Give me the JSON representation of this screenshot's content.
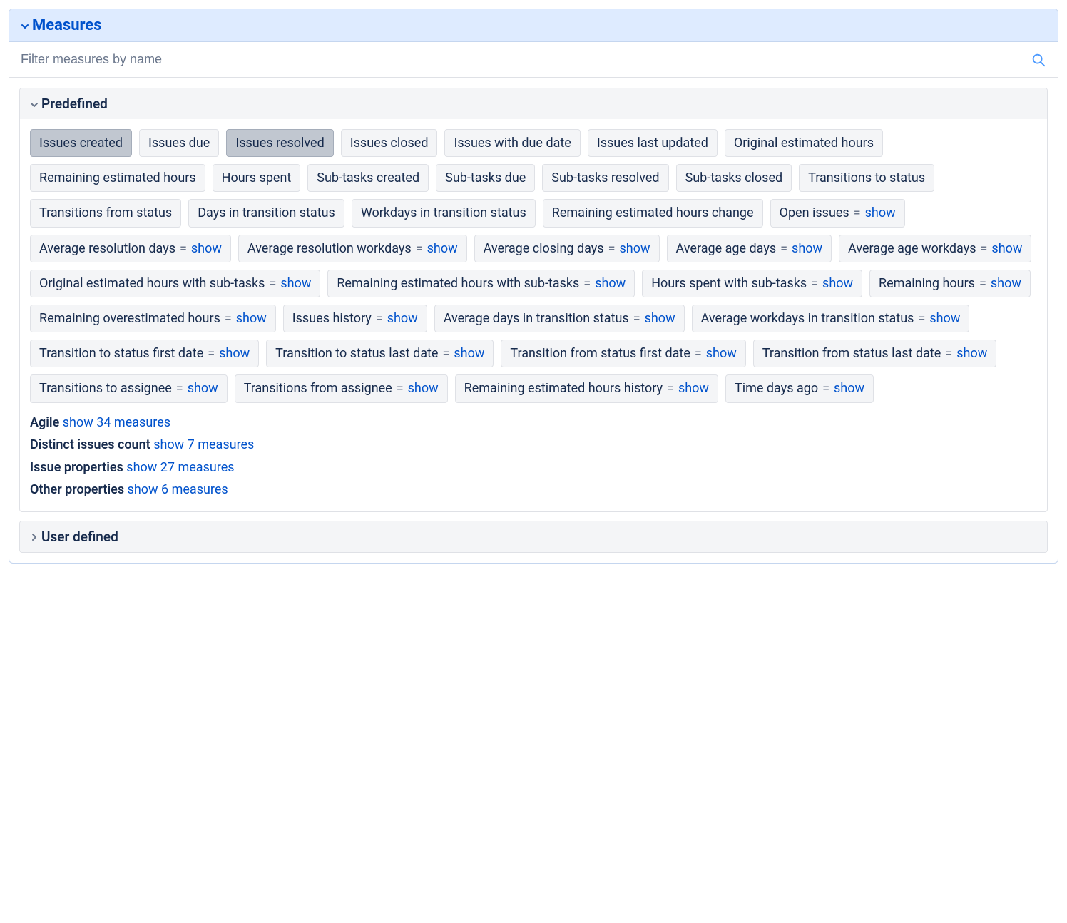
{
  "panel": {
    "title": "Measures"
  },
  "filter": {
    "placeholder": "Filter measures by name"
  },
  "sections": {
    "predefined": {
      "title": "Predefined",
      "expanded": true
    },
    "user_defined": {
      "title": "User defined",
      "expanded": false
    }
  },
  "eq": "=",
  "show": "show",
  "chips": [
    {
      "label": "Issues created",
      "selected": true
    },
    {
      "label": "Issues due"
    },
    {
      "label": "Issues resolved",
      "selected": true
    },
    {
      "label": "Issues closed"
    },
    {
      "label": "Issues with due date"
    },
    {
      "label": "Issues last updated"
    },
    {
      "label": "Original estimated hours"
    },
    {
      "label": "Remaining estimated hours"
    },
    {
      "label": "Hours spent"
    },
    {
      "label": "Sub-tasks created"
    },
    {
      "label": "Sub-tasks due"
    },
    {
      "label": "Sub-tasks resolved"
    },
    {
      "label": "Sub-tasks closed"
    },
    {
      "label": "Transitions to status"
    },
    {
      "label": "Transitions from status"
    },
    {
      "label": "Days in transition status"
    },
    {
      "label": "Workdays in transition status"
    },
    {
      "label": "Remaining estimated hours change"
    },
    {
      "label": "Open issues",
      "show": true
    },
    {
      "label": "Average resolution days",
      "show": true
    },
    {
      "label": "Average resolution workdays",
      "show": true
    },
    {
      "label": "Average closing days",
      "show": true
    },
    {
      "label": "Average age days",
      "show": true
    },
    {
      "label": "Average age workdays",
      "show": true
    },
    {
      "label": "Original estimated hours with sub-tasks",
      "show": true
    },
    {
      "label": "Remaining estimated hours with sub-tasks",
      "show": true
    },
    {
      "label": "Hours spent with sub-tasks",
      "show": true
    },
    {
      "label": "Remaining hours",
      "show": true
    },
    {
      "label": "Remaining overestimated hours",
      "show": true
    },
    {
      "label": "Issues history",
      "show": true
    },
    {
      "label": "Average days in transition status",
      "show": true
    },
    {
      "label": "Average workdays in transition status",
      "show": true
    },
    {
      "label": "Transition to status first date",
      "show": true
    },
    {
      "label": "Transition to status last date",
      "show": true
    },
    {
      "label": "Transition from status first date",
      "show": true
    },
    {
      "label": "Transition from status last date",
      "show": true
    },
    {
      "label": "Transitions to assignee",
      "show": true
    },
    {
      "label": "Transitions from assignee",
      "show": true
    },
    {
      "label": "Remaining estimated hours history",
      "show": true
    },
    {
      "label": "Time days ago",
      "show": true
    }
  ],
  "subs": [
    {
      "label": "Agile",
      "link": "show 34 measures"
    },
    {
      "label": "Distinct issues count",
      "link": "show 7 measures"
    },
    {
      "label": "Issue properties",
      "link": "show 27 measures"
    },
    {
      "label": "Other properties",
      "link": "show 6 measures"
    }
  ]
}
